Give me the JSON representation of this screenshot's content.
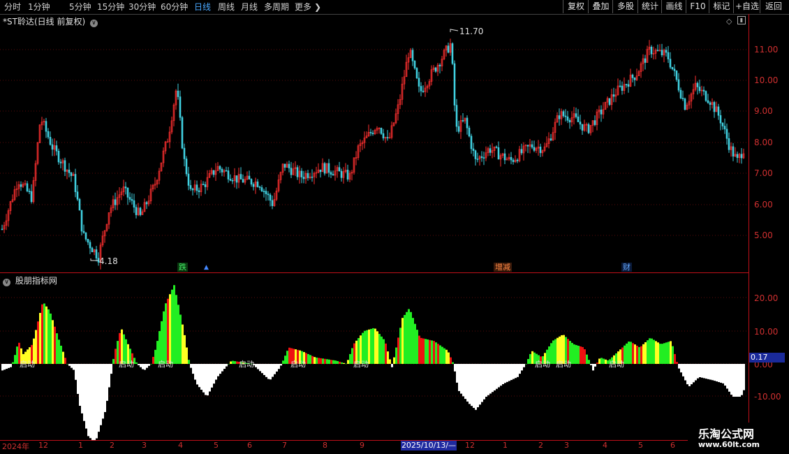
{
  "toolbar": {
    "periods": [
      "分时",
      "1分钟",
      "5分钟",
      "15分钟",
      "30分钟",
      "60分钟",
      "日线",
      "周线",
      "月线",
      "多周期",
      "更多"
    ],
    "active_period": "日线",
    "buttons": [
      "复权",
      "叠加",
      "多股",
      "统计",
      "画线",
      "F10",
      "标记",
      "+自选",
      "返回"
    ]
  },
  "chart": {
    "title": "*ST聆达(日线 前复权)",
    "max_label": "11.70",
    "min_label": "4.18",
    "price_ticks": [
      "11.00",
      "10.00",
      "9.00",
      "8.00",
      "7.00",
      "6.00",
      "5.00"
    ],
    "flags": [
      {
        "text": "跌",
        "color": "#22aa44"
      },
      {
        "text": "增减",
        "color": "#cc6622"
      },
      {
        "text": "财",
        "color": "#4488cc"
      }
    ]
  },
  "indicator": {
    "title": "股朋指标网",
    "ticks": [
      "20.00",
      "10.00",
      "0.00",
      "-10.00"
    ],
    "current_value": "0.17",
    "signal_label": "启动"
  },
  "time_axis": {
    "labels": [
      "2024年",
      "12",
      "1",
      "2",
      "3",
      "4",
      "5",
      "6",
      "7",
      "8",
      "9",
      "12",
      "1",
      "2",
      "3",
      "4",
      "5",
      "6"
    ],
    "cursor_date": "2025/10/13/—"
  },
  "watermark": {
    "line1": "乐淘公式网",
    "line2": "www.60lt.com"
  },
  "colors": {
    "up": "#ff3030",
    "down": "#40d0e0",
    "axis": "#c0101a",
    "green": "#22ee22",
    "yellow": "#ffff22",
    "red": "#ee1111",
    "white": "#ffffff"
  }
}
